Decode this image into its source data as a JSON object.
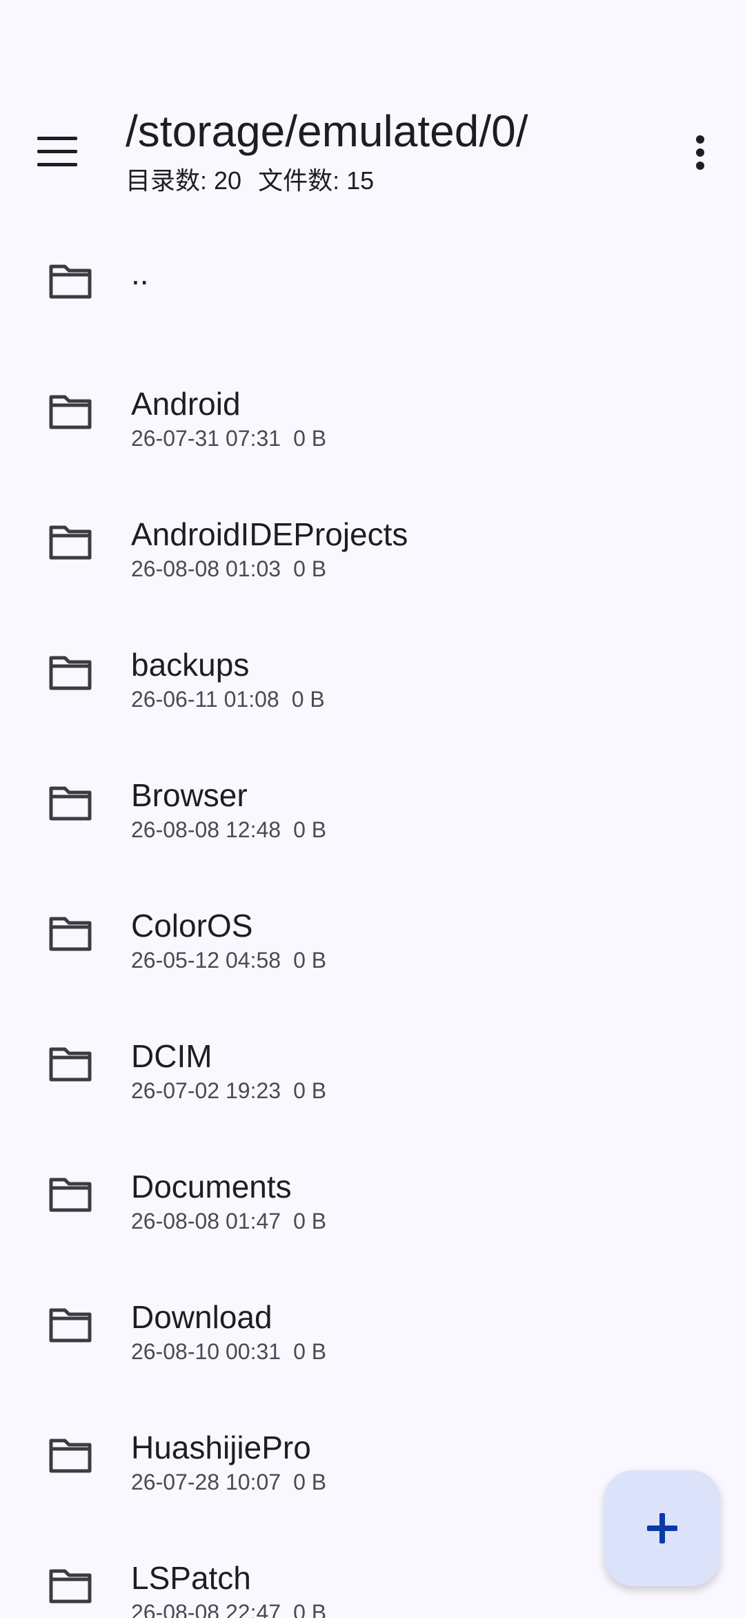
{
  "header": {
    "path": "/storage/emulated/0/",
    "dir_count_label": "目录数: 20",
    "file_count_label": "文件数: 15"
  },
  "icons": {
    "menu": "menu-icon",
    "more": "more-vert-icon",
    "folder": "folder-icon",
    "add": "add-icon"
  },
  "colors": {
    "background": "#f8f8fe",
    "fab_background": "#dce2f9",
    "fab_icon": "#0b3aa6",
    "text_primary": "#1d1d23",
    "text_secondary": "#4a4a52"
  },
  "items": [
    {
      "name": "..",
      "date": "",
      "size": ""
    },
    {
      "name": "Android",
      "date": "26-07-31 07:31",
      "size": "0 B"
    },
    {
      "name": "AndroidIDEProjects",
      "date": "26-08-08 01:03",
      "size": "0 B"
    },
    {
      "name": "backups",
      "date": "26-06-11 01:08",
      "size": "0 B"
    },
    {
      "name": "Browser",
      "date": "26-08-08 12:48",
      "size": "0 B"
    },
    {
      "name": "ColorOS",
      "date": "26-05-12 04:58",
      "size": "0 B"
    },
    {
      "name": "DCIM",
      "date": "26-07-02 19:23",
      "size": "0 B"
    },
    {
      "name": "Documents",
      "date": "26-08-08 01:47",
      "size": "0 B"
    },
    {
      "name": "Download",
      "date": "26-08-10 00:31",
      "size": "0 B"
    },
    {
      "name": "HuashijiePro",
      "date": "26-07-28 10:07",
      "size": "0 B"
    },
    {
      "name": "LSPatch",
      "date": "26-08-08 22:47",
      "size": "0 B"
    }
  ]
}
